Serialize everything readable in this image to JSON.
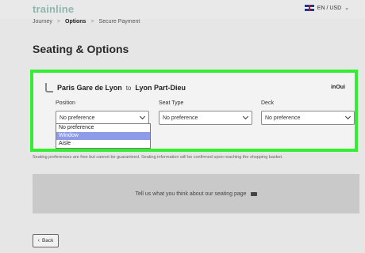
{
  "header": {
    "logo": "trainline",
    "locale": "EN / USD",
    "locale_chevron": "⌄"
  },
  "breadcrumb": {
    "items": [
      "Journey",
      "Options",
      "Secure Payment"
    ],
    "separator": ">"
  },
  "page_title": "Seating & Options",
  "journey": {
    "from": "Paris Gare de Lyon",
    "connector": "to",
    "to": "Lyon Part-Dieu",
    "operator": "inOui"
  },
  "fields": {
    "position": {
      "label": "Position",
      "value": "No preference"
    },
    "seat_type": {
      "label": "Seat Type",
      "value": "No preference"
    },
    "deck": {
      "label": "Deck",
      "value": "No preference"
    }
  },
  "position_options": [
    "No preference",
    "Window",
    "Aisle"
  ],
  "note": "Seating preferences are free but cannot be guaranteed. Seating information will be confirmed upon reaching the shopping basket.",
  "feedback": "Tell us what you think about our seating page",
  "back_label": "Back",
  "colors": {
    "highlight_border": "#33ee33",
    "selected_option": "#8c9ce8",
    "logo": "#8cb8ad"
  }
}
